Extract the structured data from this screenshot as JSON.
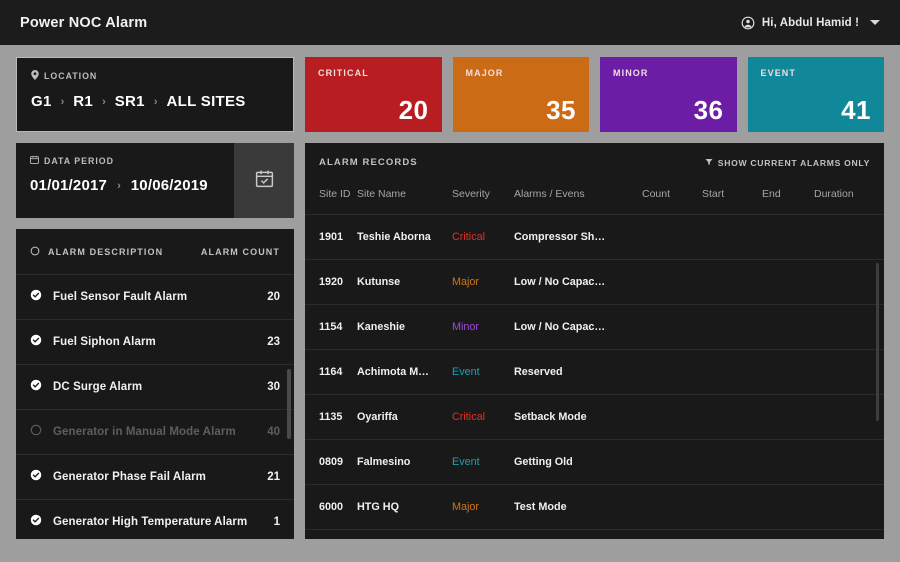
{
  "header": {
    "app_title": "Power NOC Alarm",
    "user_greeting": "Hi, Abdul Hamid !",
    "user_icon": "user-circle-icon",
    "caret_icon": "chevron-down-icon"
  },
  "location": {
    "label": "LOCATION",
    "icon": "map-pin-icon",
    "crumbs": [
      "G1",
      "R1",
      "SR1",
      "ALL SITES"
    ],
    "separator": "›"
  },
  "data_period": {
    "label": "DATA PERIOD",
    "icon": "calendar-icon",
    "start": "01/01/2017",
    "end": "10/06/2019",
    "separator": "›",
    "button_icon": "calendar-check-icon"
  },
  "alarm_description": {
    "header_icon": "circle-icon",
    "header_label": "ALARM DESCRIPTION",
    "count_label": "ALARM COUNT",
    "rows": [
      {
        "name": "Fuel Sensor Fault Alarm",
        "count": "20",
        "selected": true,
        "icon": "check-circle-icon"
      },
      {
        "name": "Fuel Siphon Alarm",
        "count": "23",
        "selected": true,
        "icon": "check-circle-icon"
      },
      {
        "name": "DC Surge Alarm",
        "count": "30",
        "selected": true,
        "icon": "check-circle-icon"
      },
      {
        "name": "Generator in Manual Mode Alarm",
        "count": "40",
        "selected": false,
        "icon": "circle-icon"
      },
      {
        "name": "Generator Phase Fail Alarm",
        "count": "21",
        "selected": true,
        "icon": "check-circle-icon"
      },
      {
        "name": "Generator High Temperature Alarm",
        "count": "1",
        "selected": true,
        "icon": "check-circle-icon"
      }
    ]
  },
  "stats": [
    {
      "label": "CRITICAL",
      "value": "20",
      "color": "#b81d22"
    },
    {
      "label": "MAJOR",
      "value": "35",
      "color": "#cc6b16"
    },
    {
      "label": "MINOR",
      "value": "36",
      "color": "#6b1ea5"
    },
    {
      "label": "EVENT",
      "value": "41",
      "color": "#10889a"
    }
  ],
  "records": {
    "title": "ALARM RECORDS",
    "filter_label": "SHOW CURRENT ALARMS ONLY",
    "filter_icon": "funnel-icon",
    "columns": [
      "Site ID",
      "Site Name",
      "Severity",
      "Alarms / Evens",
      "Count",
      "Start",
      "End",
      "Duration"
    ],
    "severity_colors": {
      "Critical": "#d9342b",
      "Major": "#d2741a",
      "Minor": "#a04bd4",
      "Event": "#19a3b5"
    },
    "rows": [
      {
        "site_id": "1901",
        "site_name": "Teshie Aborna",
        "severity": "Critical",
        "alarm": "Compressor Sh…",
        "count": "",
        "start": "",
        "end": "",
        "duration": ""
      },
      {
        "site_id": "1920",
        "site_name": "Kutunse",
        "severity": "Major",
        "alarm": "Low / No Capac…",
        "count": "",
        "start": "",
        "end": "",
        "duration": ""
      },
      {
        "site_id": "1154",
        "site_name": "Kaneshie",
        "severity": "Minor",
        "alarm": "Low / No Capac…",
        "count": "",
        "start": "",
        "end": "",
        "duration": ""
      },
      {
        "site_id": "1164",
        "site_name": "Achimota M…",
        "severity": "Event",
        "alarm": "Reserved",
        "count": "",
        "start": "",
        "end": "",
        "duration": ""
      },
      {
        "site_id": "1135",
        "site_name": "Oyariffa",
        "severity": "Critical",
        "alarm": "Setback Mode",
        "count": "",
        "start": "",
        "end": "",
        "duration": ""
      },
      {
        "site_id": "0809",
        "site_name": "Falmesino",
        "severity": "Event",
        "alarm": "Getting Old",
        "count": "",
        "start": "",
        "end": "",
        "duration": ""
      },
      {
        "site_id": "6000",
        "site_name": "HTG HQ",
        "severity": "Major",
        "alarm": "Test Mode",
        "count": "",
        "start": "",
        "end": "",
        "duration": ""
      }
    ]
  }
}
